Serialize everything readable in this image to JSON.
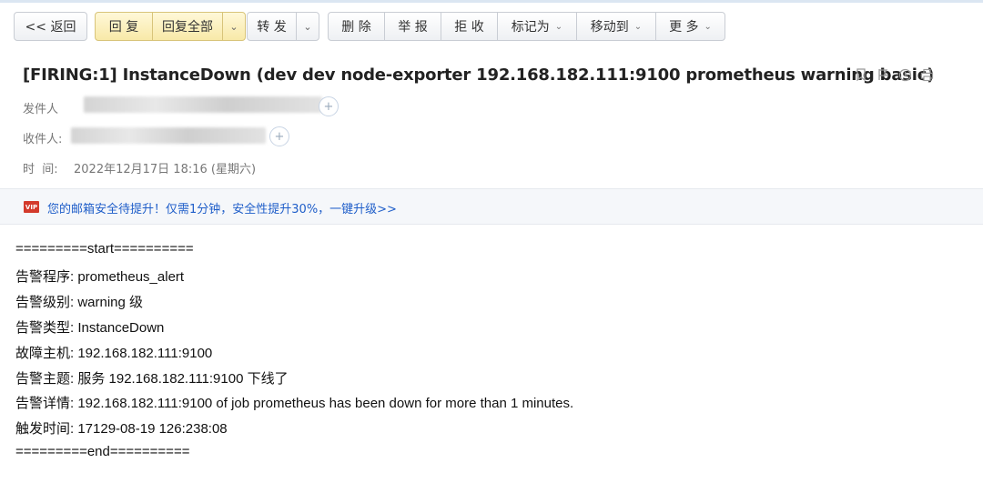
{
  "toolbar": {
    "back": "<< 返回",
    "reply": "回 复",
    "reply_all": "回复全部",
    "forward": "转 发",
    "delete": "删 除",
    "report": "举 报",
    "reject": "拒 收",
    "mark_as": "标记为",
    "move_to": "移动到",
    "more": "更 多"
  },
  "email": {
    "subject": "[FIRING:1] InstanceDown (dev dev node-exporter 192.168.182.111:9100 prometheus warning basic)",
    "sender_label": "发件人",
    "recipient_label": "收件人:",
    "time_label": "时  间:",
    "time_value": "2022年12月17日 18:16 (星期六)"
  },
  "notice": {
    "badge": "VIP",
    "text": "您的邮箱安全待提升！仅需1分钟，安全性提升30%，一键升级>>"
  },
  "body_lines": [
    "=========start==========",
    "告警程序: prometheus_alert",
    "告警级别: warning 级",
    "告警类型: InstanceDown",
    "故障主机: 192.168.182.111:9100",
    "告警主题: 服务 192.168.182.111:9100 下线了",
    "告警详情: 192.168.182.111:9100 of job prometheus has been down for more than 1 minutes.",
    "触发时间: 17129-08-19 126:238:08",
    "=========end=========="
  ],
  "icons": [
    "bookmark-icon",
    "flag-icon",
    "clock-icon",
    "print-icon",
    "plus-icon",
    "chevron-down-icon"
  ]
}
